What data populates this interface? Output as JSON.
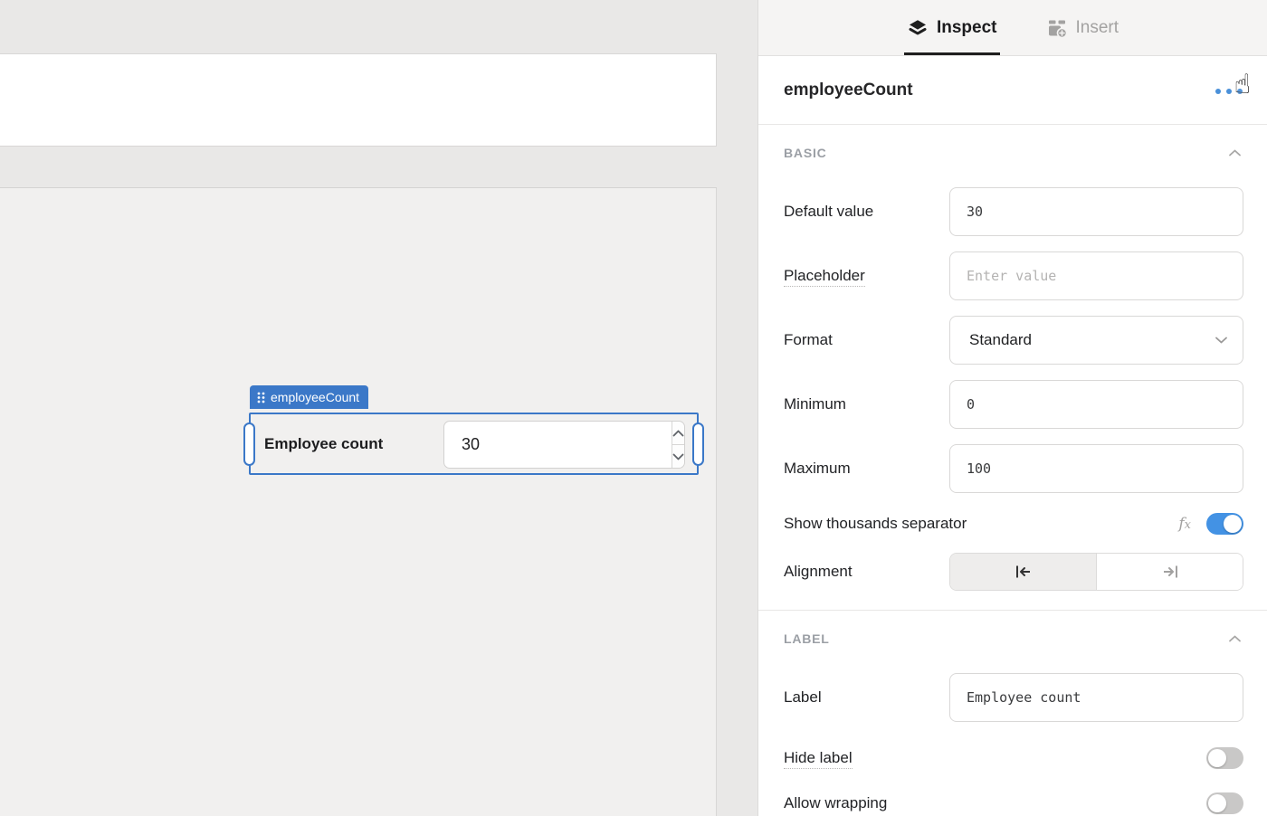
{
  "colors": {
    "accent_blue": "#3b78c8",
    "toggle_on": "#4392e4",
    "tab_active": "#1f1f1f",
    "canvas_bg": "#f1f0ef"
  },
  "canvas": {
    "component_tag": "employeeCount",
    "component": {
      "label": "Employee count",
      "value": "30"
    }
  },
  "inspector": {
    "tabs": {
      "inspect": "Inspect",
      "insert": "Insert"
    },
    "title": "employeeCount",
    "icons": {
      "fx": "fx",
      "hand_cursor": "☝"
    },
    "basic": {
      "heading": "BASIC",
      "default_value": {
        "label": "Default value",
        "value": "30"
      },
      "placeholder": {
        "label": "Placeholder",
        "placeholder": "Enter value"
      },
      "format": {
        "label": "Format",
        "value": "Standard"
      },
      "minimum": {
        "label": "Minimum",
        "value": "0"
      },
      "maximum": {
        "label": "Maximum",
        "value": "100"
      },
      "thousands": {
        "label": "Show thousands separator",
        "enabled": true
      },
      "alignment": {
        "label": "Alignment",
        "selected": "left"
      }
    },
    "label_section": {
      "heading": "LABEL",
      "label_field": {
        "label": "Label",
        "value": "Employee count"
      },
      "hide_label": {
        "label": "Hide label",
        "enabled": false
      },
      "allow_wrapping": {
        "label": "Allow wrapping",
        "enabled": false
      }
    }
  }
}
